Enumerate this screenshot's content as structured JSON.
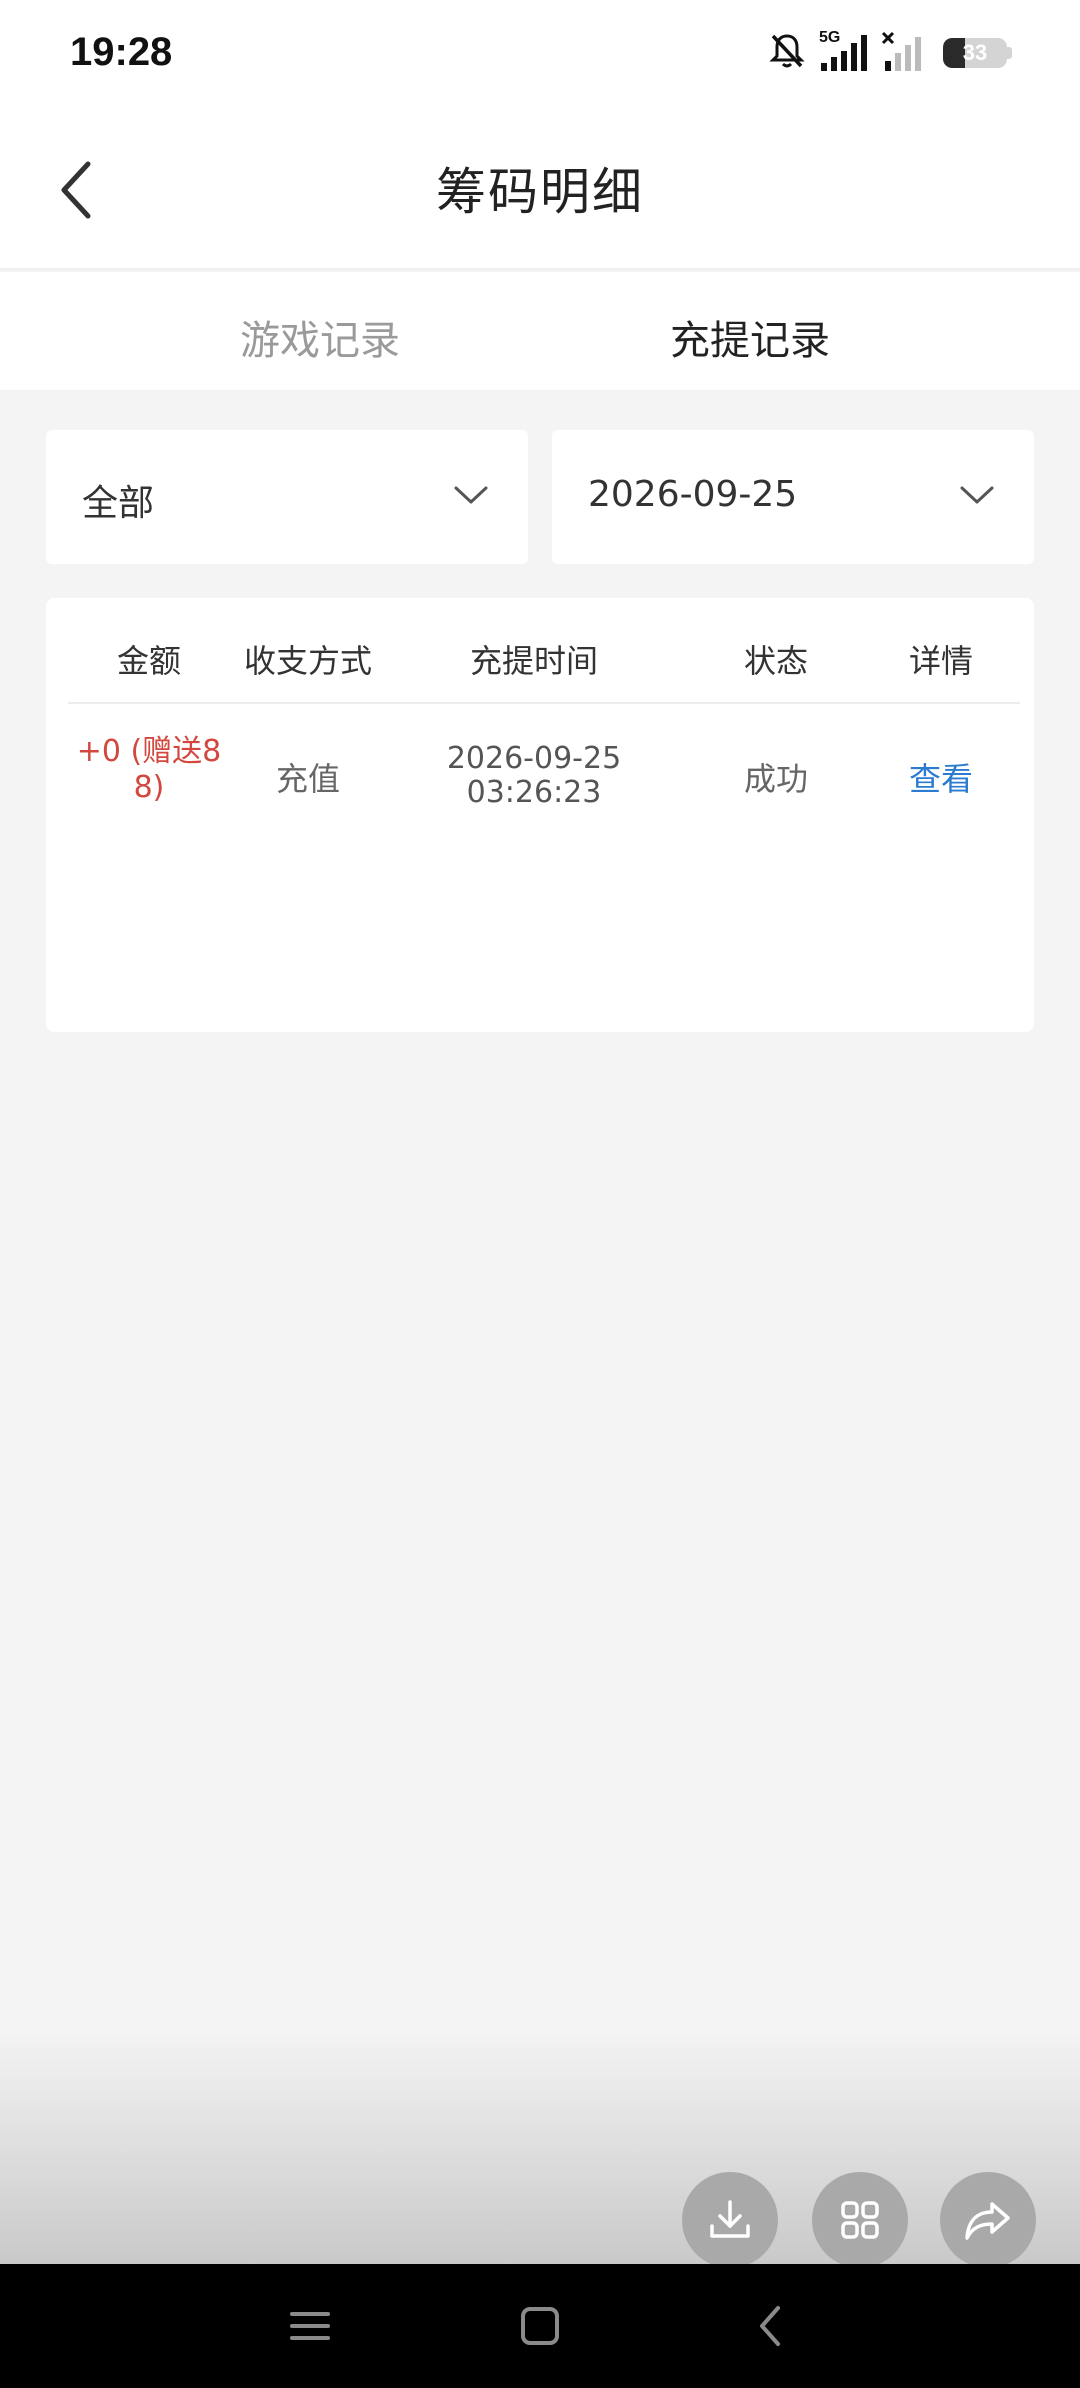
{
  "status_bar": {
    "time": "19:28",
    "network_label": "5G",
    "battery": "33",
    "icons": [
      "bell-muted-icon",
      "signal-5g-icon",
      "signal-no-service-icon",
      "battery-icon"
    ]
  },
  "header": {
    "title": "筹码明细",
    "back_icon": "chevron-left-icon"
  },
  "tabs": [
    {
      "label": "游戏记录",
      "active": false
    },
    {
      "label": "充提记录",
      "active": true
    }
  ],
  "filters": {
    "category": {
      "value": "全部",
      "icon": "chevron-down-icon"
    },
    "date": {
      "value": "2026-09-25",
      "icon": "chevron-down-icon"
    }
  },
  "table": {
    "columns": [
      "金额",
      "收支方式",
      "充提时间",
      "状态",
      "详情"
    ],
    "rows": [
      {
        "amount_line1": "+0 (赠送8",
        "amount_line2": "8)",
        "method": "充值",
        "date": "2026-09-25",
        "time": "03:26:23",
        "status": "成功",
        "detail": "查看"
      }
    ]
  },
  "floating_actions": [
    "download-icon",
    "apps-grid-icon",
    "share-icon"
  ],
  "navigation_bar": [
    "menu-icon",
    "home-icon",
    "back-icon"
  ],
  "colors": {
    "amount": "#d2483e",
    "link": "#2b7bd0",
    "background": "#f4f4f4"
  }
}
